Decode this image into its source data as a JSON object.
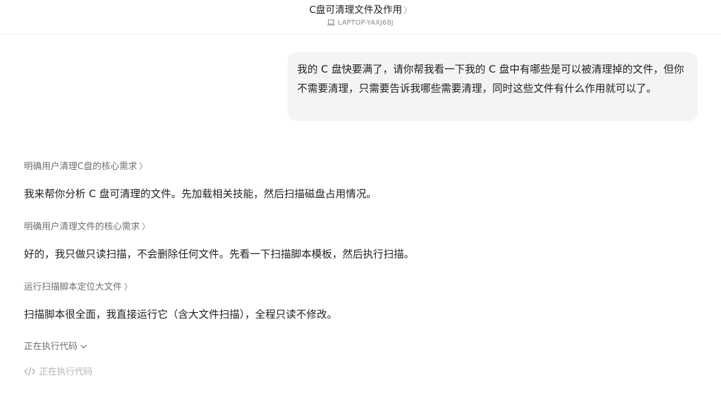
{
  "header": {
    "title": "C盘可清理文件及作用",
    "title_chevron": "〉",
    "device_icon": "laptop-icon",
    "device_name": "LAPTOP-YAXJ68J"
  },
  "user_message": {
    "text": "我的 C 盘快要满了，请你帮我看一下我的 C 盘中有哪些是可以被清理掉的文件，但你不需要清理，只需要告诉我哪些需要清理，同时这些文件有什么作用就可以了。"
  },
  "assistant": {
    "steps": [
      {
        "label": "明确用户清理C盘的核心需求",
        "arrow": "〉",
        "reply": "我来帮你分析 C 盘可清理的文件。先加载相关技能，然后扫描磁盘占用情况。"
      },
      {
        "label": "明确用户清理文件的核心需求",
        "arrow": "〉",
        "reply": "好的，我只做只读扫描，不会删除任何文件。先看一下扫描脚本模板，然后执行扫描。"
      },
      {
        "label": "运行扫描脚本定位大文件",
        "arrow": "〉",
        "reply": "扫描脚本很全面，我直接运行它（含大文件扫描），全程只读不修改。"
      }
    ],
    "running": {
      "label": "正在执行代码",
      "icon": "chevron-down-icon"
    },
    "code_status": {
      "label": "正在执行代码",
      "icon": "code-icon"
    }
  }
}
